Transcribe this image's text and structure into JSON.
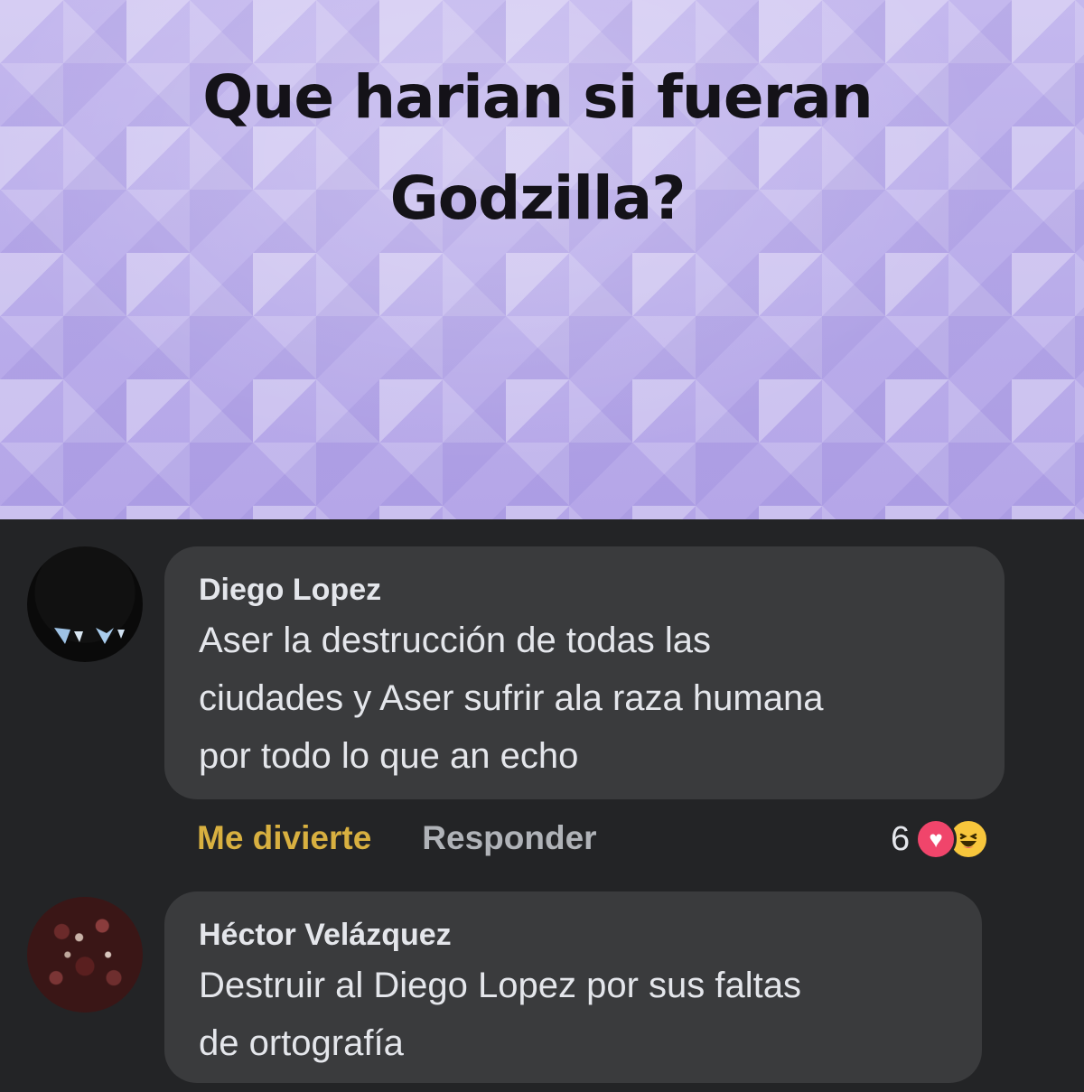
{
  "story": {
    "title": "Que harian si fueran\nGodzilla?",
    "background_color": "#bdb0ea"
  },
  "comments": [
    {
      "author": "Diego Lopez",
      "text": "Aser la destrucción de todas las\nciudades y Aser sufrir ala raza humana\npor todo lo que an echo",
      "actions": {
        "react_label": "Me divierte",
        "reply_label": "Responder"
      },
      "reactions": {
        "count": "6",
        "icons": [
          "heart-icon",
          "haha-icon"
        ]
      }
    },
    {
      "author": "Héctor Velázquez",
      "text": "Destruir al Diego Lopez por sus faltas\nde ortografía"
    }
  ],
  "colors": {
    "comment_bg": "#232426",
    "bubble_bg": "#3a3b3d",
    "react_active": "#d8b040",
    "reply_gray": "#b0b3b8"
  }
}
